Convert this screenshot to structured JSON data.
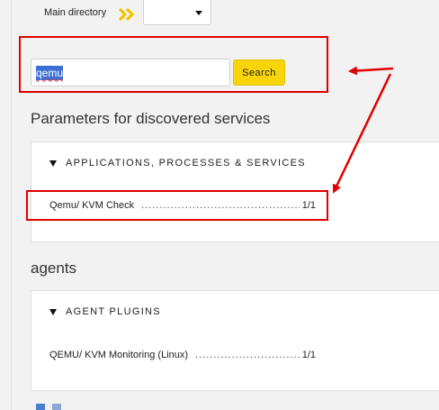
{
  "directory": {
    "label": "Main directory",
    "selected": ""
  },
  "search": {
    "value": "qemu",
    "button_label": "Search"
  },
  "sections": [
    {
      "title": "Parameters for discovered services",
      "group": "APPLICATIONS, PROCESSES & SERVICES",
      "items": [
        {
          "label": "Qemu/ KVM Check",
          "count": "1/1"
        }
      ]
    },
    {
      "title": "agents",
      "group": "AGENT PLUGINS",
      "items": [
        {
          "label": "QEMU/ KVM Monitoring (Linux)",
          "count": "1/1"
        }
      ]
    }
  ],
  "colors": {
    "accent": "#f8d50b",
    "annotation": "#e00000",
    "selection": "#3b6fd6"
  }
}
